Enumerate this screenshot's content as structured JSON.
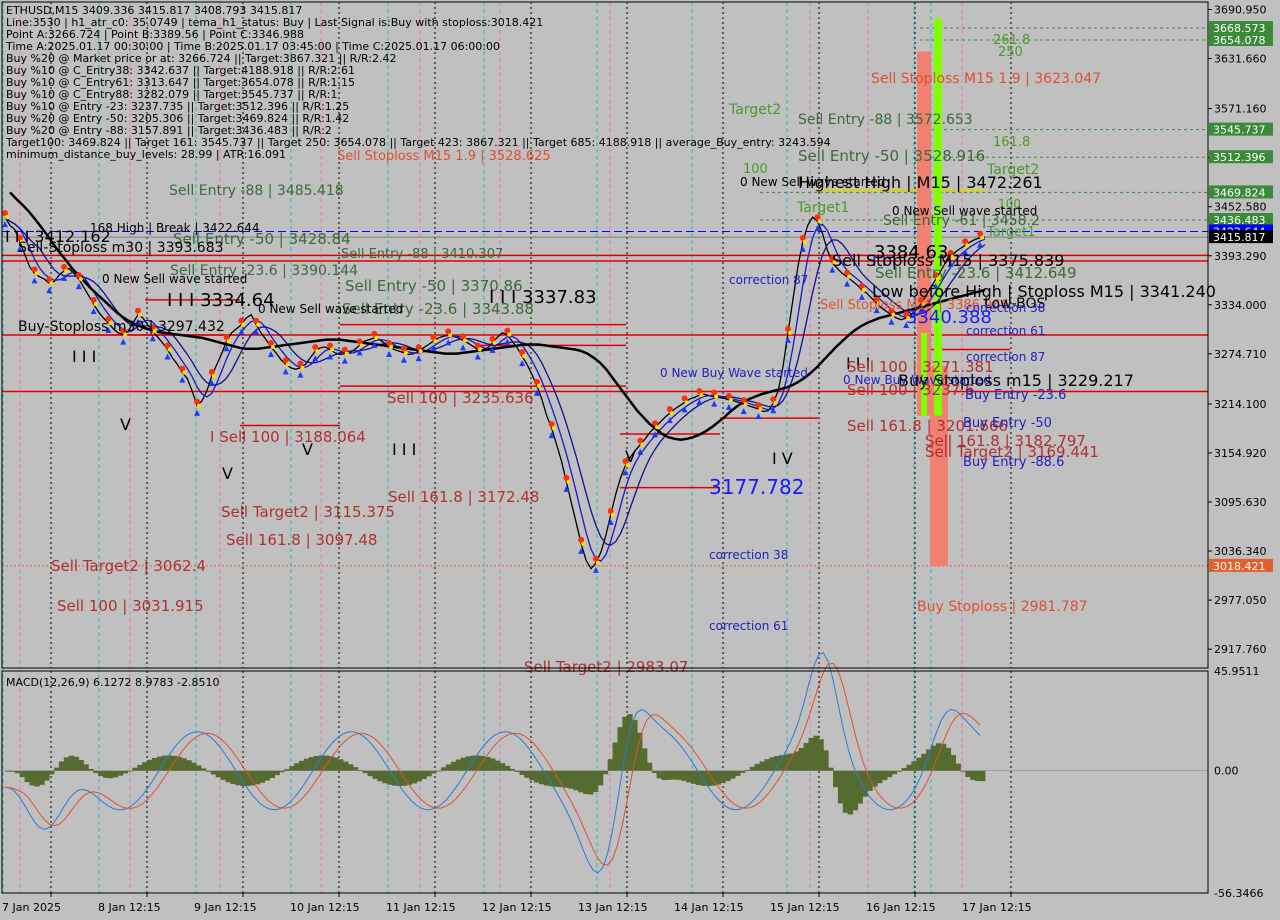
{
  "chart_data": [
    {
      "type": "candlestick",
      "title": "ETHUSD,M15  3409.336 3415.817 3408.793 3415.817",
      "symbol": "ETHUSD",
      "timeframe": "M15",
      "ohlc_last": {
        "open": 3409.336,
        "high": 3415.817,
        "low": 3408.793,
        "close": 3415.817
      },
      "ylim": [
        2895,
        3700
      ],
      "price_ticks": [
        "3690.950",
        "3631.660",
        "3571.160",
        "3511.810",
        "3452.580",
        "3393.290",
        "3334.000",
        "3274.710",
        "3214.100",
        "3154.920",
        "3095.630",
        "3036.340",
        "2977.050",
        "2917.760"
      ],
      "price_tick_values": [
        3690.95,
        3631.66,
        3571.16,
        3511.81,
        3452.58,
        3393.29,
        3334.0,
        3274.71,
        3214.1,
        3154.92,
        3095.63,
        3036.34,
        2977.05,
        2917.76
      ],
      "date_ticks": [
        "7 Jan 2025",
        "8 Jan 12:15",
        "9 Jan 12:15",
        "10 Jan 12:15",
        "11 Jan 12:15",
        "12 Jan 12:15",
        "13 Jan 12:15",
        "14 Jan 12:15",
        "15 Jan 12:15",
        "16 Jan 12:15",
        "17 Jan 12:15"
      ],
      "price_badges": [
        {
          "label": "3668.573",
          "value": 3668.573,
          "color": "#3a8a3a"
        },
        {
          "label": "3654.078",
          "value": 3654.078,
          "color": "#3a8a3a"
        },
        {
          "label": "3545.737",
          "value": 3545.737,
          "color": "#3a8a3a"
        },
        {
          "label": "3512.396",
          "value": 3512.396,
          "color": "#3a8a3a"
        },
        {
          "label": "3469.824",
          "value": 3469.824,
          "color": "#3a8a3a"
        },
        {
          "label": "3436.483",
          "value": 3436.483,
          "color": "#3a8a3a"
        },
        {
          "label": "3422.644",
          "value": 3422.644,
          "color": "#0000ff"
        },
        {
          "label": "3415.817",
          "value": 3415.817,
          "color": "#000000"
        },
        {
          "label": "3018.421",
          "value": 3018.421,
          "color": "#e06030"
        }
      ],
      "info_lines": [
        "ETHUSD,M15  3409.336 3415.817 3408.793 3415.817",
        "Line:3530 | h1_atr_c0: 35.0749 | tema_h1_status: Buy | Last Signal is:Buy with stoploss:3018.421",
        "Point A:3266.724 | Point B:3389.56 | Point C:3346.988",
        "Time A:2025.01.17 00:30:00 | Time B:2025.01.17 03:45:00 | Time C:2025.01.17 06:00:00",
        "Buy %20 @ Market price or at: 3266.724 || Target:3867.321 || R/R:2.42",
        "Buy %10 @ C_Entry38: 3342.637 || Target:4188.918 || R/R:2.61",
        "Buy %10 @ C_Entry61: 3313.647 || Target:3654.078 || R/R:1.15",
        "Buy %10 @ C_Entry88: 3282.079 || Target:3545.737 || R/R:1",
        "Buy %10 @ Entry -23: 3237.735 || Target:3512.396 || R/R:1.25",
        "Buy %20 @ Entry -50: 3205.306 || Target:3469.824 || R/R:1.42",
        "Buy %20 @ Entry -88: 3157.891 || Target:3436.483 || R/R:2",
        "Target100: 3469.824 || Target 161: 3545.737 || Target 250: 3654.078 || Target 423: 3867.321 || Target 685: 4188.918 || average_Buy_entry: 3243.594",
        "minimum_distance_buy_levels: 28.99 | ATR:16.091"
      ],
      "close_series": [
        3440,
        3430,
        3425,
        3410,
        3395,
        3380,
        3372,
        3368,
        3365,
        3360,
        3362,
        3370,
        3375,
        3378,
        3372,
        3365,
        3355,
        3345,
        3335,
        3325,
        3318,
        3312,
        3305,
        3300,
        3298,
        3302,
        3312,
        3322,
        3318,
        3310,
        3302,
        3295,
        3288,
        3280,
        3270,
        3262,
        3252,
        3245,
        3230,
        3212,
        3218,
        3230,
        3248,
        3262,
        3275,
        3290,
        3300,
        3305,
        3310,
        3318,
        3322,
        3310,
        3300,
        3292,
        3283,
        3276,
        3268,
        3262,
        3258,
        3256,
        3258,
        3262,
        3270,
        3278,
        3282,
        3283,
        3280,
        3276,
        3274,
        3275,
        3276,
        3280,
        3285,
        3290,
        3292,
        3294,
        3292,
        3288,
        3283,
        3280,
        3278,
        3276,
        3274,
        3275,
        3278,
        3282,
        3286,
        3290,
        3294,
        3296,
        3297,
        3296,
        3294,
        3291,
        3288,
        3284,
        3280,
        3278,
        3282,
        3288,
        3295,
        3300,
        3298,
        3290,
        3282,
        3272,
        3262,
        3250,
        3236,
        3220,
        3200,
        3185,
        3165,
        3145,
        3120,
        3095,
        3070,
        3045,
        3025,
        3015,
        3022,
        3035,
        3055,
        3080,
        3105,
        3125,
        3140,
        3150,
        3158,
        3165,
        3172,
        3180,
        3186,
        3192,
        3198,
        3203,
        3208,
        3212,
        3216,
        3220,
        3222,
        3225,
        3226,
        3224,
        3223,
        3222,
        3221,
        3219,
        3218,
        3216,
        3214,
        3212,
        3210,
        3208,
        3205,
        3206,
        3215,
        3230,
        3260,
        3300,
        3340,
        3380,
        3410,
        3430,
        3440,
        3435,
        3420,
        3400,
        3385,
        3378,
        3372,
        3368,
        3363,
        3358,
        3352,
        3348,
        3342,
        3336,
        3330,
        3326,
        3322,
        3318,
        3316,
        3318,
        3322,
        3328,
        3335,
        3345,
        3355,
        3365,
        3375,
        3385,
        3392,
        3398,
        3402,
        3406,
        3410,
        3413,
        3415,
        3416
      ],
      "ma_black_series": [
        3470,
        3462,
        3455,
        3447,
        3438,
        3428,
        3418,
        3407,
        3397,
        3388,
        3378,
        3370,
        3362,
        3354,
        3347,
        3340,
        3333,
        3326,
        3320,
        3315,
        3311,
        3308,
        3305,
        3303,
        3301,
        3300,
        3299,
        3298,
        3297,
        3296,
        3295,
        3294,
        3292,
        3290,
        3288,
        3286,
        3284,
        3282,
        3281,
        3281,
        3281,
        3282,
        3283,
        3284,
        3285,
        3286,
        3287,
        3288,
        3289,
        3290,
        3291,
        3292,
        3292,
        3292,
        3291,
        3290,
        3289,
        3288,
        3287,
        3286,
        3285,
        3284,
        3283,
        3282,
        3281,
        3280,
        3279,
        3278,
        3277,
        3276,
        3275,
        3275,
        3275,
        3276,
        3277,
        3278,
        3279,
        3280,
        3281,
        3282,
        3283,
        3284,
        3285,
        3286,
        3286,
        3286,
        3285,
        3284,
        3283,
        3282,
        3281,
        3280,
        3278,
        3275,
        3270,
        3264,
        3256,
        3246,
        3236,
        3226,
        3216,
        3206,
        3198,
        3190,
        3184,
        3178,
        3174,
        3172,
        3171,
        3172,
        3174,
        3177,
        3181,
        3186,
        3192,
        3198,
        3205,
        3211,
        3216,
        3220,
        3223,
        3226,
        3228,
        3230,
        3232,
        3234,
        3237,
        3241,
        3246,
        3252,
        3259,
        3267,
        3275,
        3283,
        3290,
        3297,
        3303,
        3308,
        3312,
        3315,
        3318,
        3320,
        3322,
        3324,
        3326,
        3328,
        3330,
        3332,
        3334,
        3336,
        3338,
        3340,
        3342,
        3344,
        3346,
        3348,
        3350,
        3352
      ],
      "macd": {
        "title": "MACD(12,26,9) 6.1272 8.9783 -2.8510",
        "params": [
          12,
          26,
          9
        ],
        "macd_value": 6.1272,
        "signal_value": 8.9783,
        "histogram_value": -2.851,
        "ylim": [
          -56.3466,
          45.9511
        ],
        "ticks": [
          "45.9511",
          "0.00",
          "-56.3466"
        ],
        "tick_values": [
          45.9511,
          0.0,
          -56.3466
        ]
      }
    }
  ],
  "annotations": [
    {
      "text": "Sell Stoploss M15 1.9 | 3623.047",
      "color": "#e05030",
      "size": 14,
      "anchor": "start"
    },
    {
      "text": "261.8",
      "color": "#4a9a2a",
      "size": 13,
      "anchor": "start"
    },
    {
      "text": "250",
      "color": "#4a9a2a",
      "size": 13,
      "anchor": "start"
    },
    {
      "text": "Target2",
      "color": "#4a9a2a",
      "size": 14,
      "anchor": "start"
    },
    {
      "text": "Sell Entry -88 | 3572.653",
      "color": "#3a6a3a",
      "size": 14,
      "anchor": "start"
    },
    {
      "text": "161.8",
      "color": "#4a9a2a",
      "size": 13,
      "anchor": "start"
    },
    {
      "text": "Sell Entry -50 | 3528.916",
      "color": "#3a6a3a",
      "size": 15,
      "anchor": "start"
    },
    {
      "text": "Sell Stoploss M15 1.9 | 3528.625",
      "color": "#e05030",
      "size": 13,
      "anchor": "start"
    },
    {
      "text": "Target2",
      "color": "#4a9a2a",
      "size": 14,
      "anchor": "start"
    },
    {
      "text": "100",
      "color": "#4a9a2a",
      "size": 13,
      "anchor": "start"
    },
    {
      "text": "0 New Sell wave started",
      "color": "#000000",
      "size": 12,
      "anchor": "start"
    },
    {
      "text": "Highest High | M15 | 3472.261",
      "color": "#000000",
      "size": 16,
      "anchor": "start"
    },
    {
      "text": "Sell Entry -88 | 3485.418",
      "color": "#3a6a3a",
      "size": 14,
      "anchor": "start"
    },
    {
      "text": "100",
      "color": "#4a9a2a",
      "size": 12,
      "anchor": "start"
    },
    {
      "text": "0 New Sell wave started",
      "color": "#000000",
      "size": 12,
      "anchor": "start"
    },
    {
      "text": "Sell Entry -61 | 3458.2",
      "color": "#3a6a3a",
      "size": 14,
      "anchor": "start"
    },
    {
      "text": "Target1",
      "color": "#4a9a2a",
      "size": 13,
      "anchor": "start"
    },
    {
      "text": "I I I 3412.162",
      "color": "#000000",
      "size": 16,
      "anchor": "start"
    },
    {
      "text": "168 High | Break | 3422.644",
      "color": "#000000",
      "size": 12,
      "anchor": "start"
    },
    {
      "text": "Sell Entry -50 | 3428.84",
      "color": "#3a6a3a",
      "size": 15,
      "anchor": "start"
    },
    {
      "text": "Sell-Stoploss m30 | 3393.683",
      "color": "#000000",
      "size": 14,
      "anchor": "start"
    },
    {
      "text": "Sell Entry -88 | 3410.307",
      "color": "#3a6a3a",
      "size": 13,
      "anchor": "start"
    },
    {
      "text": "Sell Entry -23.6 | 3390.144",
      "color": "#3a6a3a",
      "size": 14,
      "anchor": "start"
    },
    {
      "text": "Sell Entry -50 | 3370.86",
      "color": "#3a6a3a",
      "size": 15,
      "anchor": "start"
    },
    {
      "text": "Sell Entry -23.6 | 3343.88",
      "color": "#3a6a3a",
      "size": 15,
      "anchor": "start"
    },
    {
      "text": "I I I 3337.83",
      "color": "#000000",
      "size": 18,
      "anchor": "start"
    },
    {
      "text": "I I I 3334.64",
      "color": "#000000",
      "size": 18,
      "anchor": "start"
    },
    {
      "text": "0 New Sell wave started",
      "color": "#000000",
      "size": 12,
      "anchor": "start"
    },
    {
      "text": "0 New Sell wave started",
      "color": "#000000",
      "size": 12,
      "anchor": "start"
    },
    {
      "text": "Buy-Stoploss m30 | 3297.432",
      "color": "#000000",
      "size": 14,
      "anchor": "start"
    },
    {
      "text": "I I I",
      "color": "#000000",
      "size": 16,
      "anchor": "start"
    },
    {
      "text": "V",
      "color": "#000000",
      "size": 16,
      "anchor": "start"
    },
    {
      "text": "V",
      "color": "#000000",
      "size": 16,
      "anchor": "start"
    },
    {
      "text": "Sell 100 | 3235.636",
      "color": "#b03030",
      "size": 15,
      "anchor": "start"
    },
    {
      "text": "I Sell 100 | 3188.064",
      "color": "#b03030",
      "size": 15,
      "anchor": "start"
    },
    {
      "text": "V",
      "color": "#000000",
      "size": 16,
      "anchor": "start"
    },
    {
      "text": "I I I",
      "color": "#000000",
      "size": 16,
      "anchor": "start"
    },
    {
      "text": "Sell 161.8 | 3172.48",
      "color": "#b03030",
      "size": 15,
      "anchor": "start"
    },
    {
      "text": "Sell Target2 | 3115.375",
      "color": "#b03030",
      "size": 15,
      "anchor": "start"
    },
    {
      "text": "Sell 161.8 | 3097.48",
      "color": "#b03030",
      "size": 15,
      "anchor": "start"
    },
    {
      "text": "Sell Target2 | 3062.4",
      "color": "#b03030",
      "size": 15,
      "anchor": "start"
    },
    {
      "text": "Sell 100 | 3031.915",
      "color": "#b03030",
      "size": 15,
      "anchor": "start"
    },
    {
      "text": "Sell Target2 | 2983.07",
      "color": "#b03030",
      "size": 15,
      "anchor": "start"
    },
    {
      "text": "0 New Buy Wave started",
      "color": "#2020c0",
      "size": 12,
      "anchor": "start"
    },
    {
      "text": "I V",
      "color": "#000000",
      "size": 16,
      "anchor": "start"
    },
    {
      "text": "V",
      "color": "#000000",
      "size": 16,
      "anchor": "start"
    },
    {
      "text": "3177.782",
      "color": "#1a1aff",
      "size": 20,
      "anchor": "start"
    },
    {
      "text": "correction 38",
      "color": "#2020c0",
      "size": 12,
      "anchor": "start"
    },
    {
      "text": "correction 61",
      "color": "#2020c0",
      "size": 12,
      "anchor": "start"
    },
    {
      "text": "correction 87",
      "color": "#2020c0",
      "size": 12,
      "anchor": "start"
    },
    {
      "text": "Target1",
      "color": "#4a9a2a",
      "size": 14,
      "anchor": "start"
    },
    {
      "text": "I I I",
      "color": "#1a1aff",
      "size": 16,
      "anchor": "start"
    },
    {
      "text": "Sell Stoploss M15 | 3375.839",
      "color": "#000000",
      "size": 16,
      "anchor": "start"
    },
    {
      "text": "3384.63",
      "color": "#000000",
      "size": 18,
      "anchor": "start"
    },
    {
      "text": "Sell Entry -23.6 | 3412.649",
      "color": "#3a6a3a",
      "size": 15,
      "anchor": "start"
    },
    {
      "text": "Sell Stoploss M15 | 3386.966",
      "color": "#e05030",
      "size": 13,
      "anchor": "start"
    },
    {
      "text": "Low before High | Stoploss M15 | 3341.240",
      "color": "#000000",
      "size": 16,
      "anchor": "start"
    },
    {
      "text": "Low-BOS",
      "color": "#000000",
      "size": 14,
      "anchor": "start"
    },
    {
      "text": "3340.388",
      "color": "#1a1aff",
      "size": 18,
      "anchor": "start"
    },
    {
      "text": "correction 38",
      "color": "#2020c0",
      "size": 12,
      "anchor": "start"
    },
    {
      "text": "correction 61",
      "color": "#2020c0",
      "size": 12,
      "anchor": "start"
    },
    {
      "text": "correction 87",
      "color": "#2020c0",
      "size": 12,
      "anchor": "start"
    },
    {
      "text": "0 New Buy Wave started",
      "color": "#2020c0",
      "size": 12,
      "anchor": "start"
    },
    {
      "text": "I I I",
      "color": "#000000",
      "size": 16,
      "anchor": "start"
    },
    {
      "text": "Buy Stoploss m15 | 3229.217",
      "color": "#000000",
      "size": 16,
      "anchor": "start"
    },
    {
      "text": "Sell 100 | 3271.381",
      "color": "#b03030",
      "size": 15,
      "anchor": "start"
    },
    {
      "text": "Sell 100 | 3237.6",
      "color": "#b03030",
      "size": 15,
      "anchor": "start"
    },
    {
      "text": "Buy Entry -23.6",
      "color": "#2020c0",
      "size": 13,
      "anchor": "start"
    },
    {
      "text": "Sell 161.8 | 3201.666",
      "color": "#b03030",
      "size": 15,
      "anchor": "start"
    },
    {
      "text": "Buy Entry -50",
      "color": "#2020c0",
      "size": 13,
      "anchor": "start"
    },
    {
      "text": "Sell 161.8 | 3182.797",
      "color": "#b03030",
      "size": 15,
      "anchor": "start"
    },
    {
      "text": "Sell Target2 | 3169.441",
      "color": "#b03030",
      "size": 15,
      "anchor": "start"
    },
    {
      "text": "Buy Entry -88.6",
      "color": "#2020c0",
      "size": 13,
      "anchor": "start"
    },
    {
      "text": "Buy Stoploss | 2981.787",
      "color": "#e05030",
      "size": 14,
      "anchor": "start"
    }
  ]
}
